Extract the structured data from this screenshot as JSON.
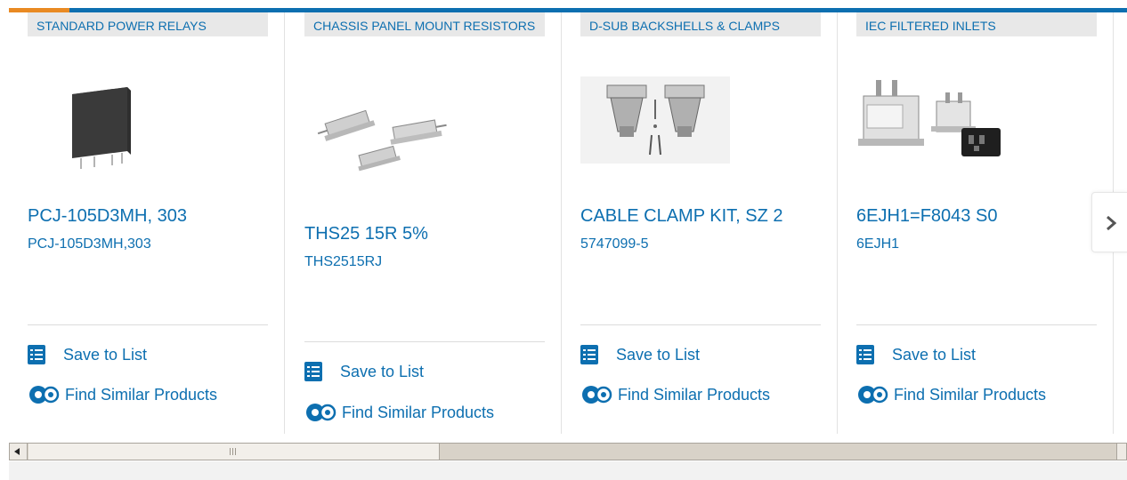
{
  "products": [
    {
      "category": "STANDARD POWER RELAYS",
      "title": "PCJ-105D3MH, 303",
      "part_number": "PCJ-105D3MH,303",
      "image_icon": "relay-image",
      "save_label": "Save to List",
      "similar_label": "Find Similar Products"
    },
    {
      "category": "CHASSIS PANEL MOUNT RESISTORS",
      "title": "THS25 15R 5%",
      "part_number": "THS2515RJ",
      "image_icon": "resistor-image",
      "save_label": "Save to List",
      "similar_label": "Find Similar Products"
    },
    {
      "category": "D-SUB BACKSHELLS & CLAMPS",
      "title": "CABLE CLAMP KIT, SZ 2",
      "part_number": "5747099-5",
      "image_icon": "backshell-image",
      "save_label": "Save to List",
      "similar_label": "Find Similar Products"
    },
    {
      "category": "IEC FILTERED INLETS",
      "title": "6EJH1=F8043 S0",
      "part_number": "6EJH1",
      "image_icon": "filtered-inlet-image",
      "save_label": "Save to List",
      "similar_label": "Find Similar Products"
    }
  ],
  "navigation": {
    "next_icon": "chevron-right-icon"
  },
  "colors": {
    "link": "#0d6fb0",
    "accent": "#e98a23",
    "tag_bg": "#e8e8e8"
  }
}
